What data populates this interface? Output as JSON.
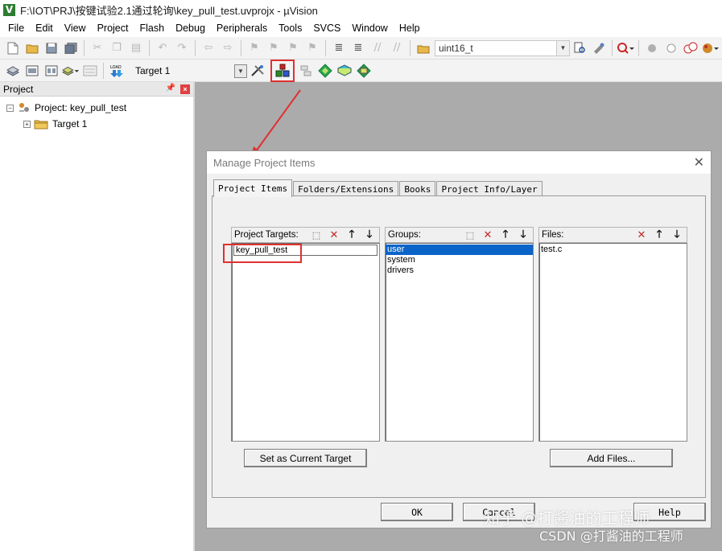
{
  "window": {
    "title": "F:\\IOT\\PRJ\\按键试验2.1通过轮询\\key_pull_test.uvprojx - µVision",
    "app_icon": "V"
  },
  "menu": [
    "File",
    "Edit",
    "View",
    "Project",
    "Flash",
    "Debug",
    "Peripherals",
    "Tools",
    "SVCS",
    "Window",
    "Help"
  ],
  "toolbar": {
    "variable_combo": "uint16_t",
    "target_combo": "Target 1"
  },
  "project_panel": {
    "title": "Project",
    "root_label": "Project: key_pull_test",
    "target_label": "Target 1"
  },
  "dialog": {
    "title": "Manage Project Items",
    "tabs": [
      "Project Items",
      "Folders/Extensions",
      "Books",
      "Project Info/Layer"
    ],
    "targets_header": "Project Targets:",
    "targets_value": "key_pull_test",
    "groups_header": "Groups:",
    "groups": [
      "user",
      "system",
      "drivers"
    ],
    "files_header": "Files:",
    "files": [
      "test.c"
    ],
    "set_current_button": "Set as Current Target",
    "add_files_button": "Add Files...",
    "ok_button": "OK",
    "cancel_button": "Cancel",
    "help_button": "Help"
  },
  "watermark": {
    "zhihu": "知乎 @打酱油的工程师",
    "csdn": "CSDN @打酱油的工程师"
  },
  "colors": {
    "highlight_red": "#e03030",
    "selection_blue": "#0a64c8",
    "workspace_gray": "#ababab"
  }
}
